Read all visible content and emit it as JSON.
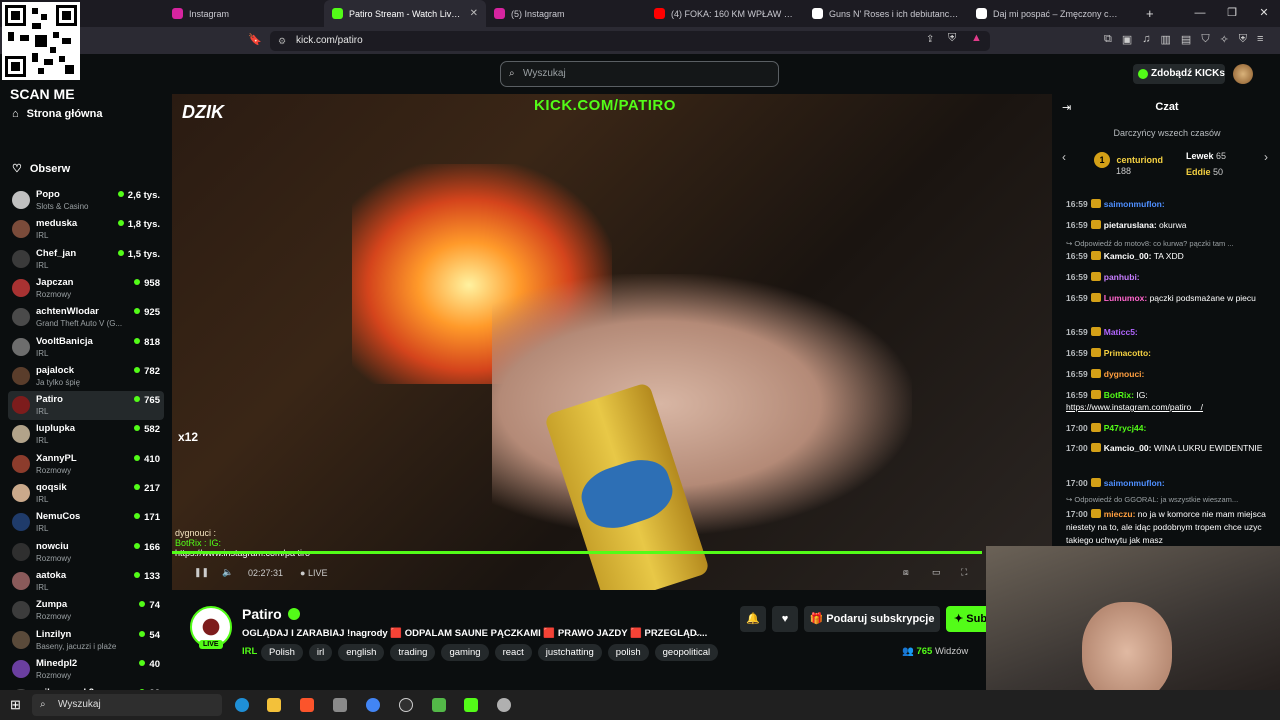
{
  "browser": {
    "tabs": [
      {
        "label": "Instagram",
        "color": "#d6249f",
        "active": false
      },
      {
        "label": "Patiro Stream - Watch Live o",
        "color": "#53fc18",
        "active": true
      },
      {
        "label": "(5) Instagram",
        "color": "#d6249f",
        "active": false
      },
      {
        "label": "(4) FOKA: 160 KM WPŁAW PRZEZ BA",
        "color": "#ff0000",
        "active": false
      },
      {
        "label": "Guns N' Roses i ich debiutancki albu",
        "color": "#ffffff",
        "active": false
      },
      {
        "label": "Daj mi pospać – Zmęczony codz",
        "color": "#ffffff",
        "active": false
      }
    ],
    "url": "kick.com/patiro"
  },
  "overlay": {
    "scan_me": "SCAN ME"
  },
  "header": {
    "search_placeholder": "Wyszukaj",
    "kicks_button": "Zdobądź KICKs"
  },
  "sidebar": {
    "nav": [
      {
        "label": "Strona główna",
        "icon": "home-icon"
      },
      {
        "label": "Obserw",
        "icon": "heart-icon"
      }
    ],
    "channels": [
      {
        "name": "Popo",
        "category": "Slots & Casino",
        "viewers": "2,6 tys.",
        "color": "#c0c0c0"
      },
      {
        "name": "meduska",
        "category": "IRL",
        "viewers": "1,8 tys.",
        "color": "#7a4b3a"
      },
      {
        "name": "Chef_jan",
        "category": "IRL",
        "viewers": "1,5 tys.",
        "color": "#3a3a3a"
      },
      {
        "name": "Japczan",
        "category": "Rozmowy",
        "viewers": "958",
        "color": "#a83232"
      },
      {
        "name": "achtenWlodar",
        "category": "Grand Theft Auto V (G...",
        "viewers": "925",
        "color": "#4a4a4a"
      },
      {
        "name": "VooltBanicja",
        "category": "IRL",
        "viewers": "818",
        "color": "#6d6d6d"
      },
      {
        "name": "pajalock",
        "category": "Ja tylko śpię",
        "viewers": "782",
        "color": "#5a3d2b"
      },
      {
        "name": "Patiro",
        "category": "IRL",
        "viewers": "765",
        "color": "#7d1c1c",
        "selected": true
      },
      {
        "name": "luplupka",
        "category": "IRL",
        "viewers": "582",
        "color": "#b2a38a"
      },
      {
        "name": "XannyPL",
        "category": "Rozmowy",
        "viewers": "410",
        "color": "#8c3c2c"
      },
      {
        "name": "qoqsik",
        "category": "IRL",
        "viewers": "217",
        "color": "#caa98b"
      },
      {
        "name": "NemuCos",
        "category": "IRL",
        "viewers": "171",
        "color": "#1f3b6a"
      },
      {
        "name": "nowciu",
        "category": "Rozmowy",
        "viewers": "166",
        "color": "#2f2f2f"
      },
      {
        "name": "aatoka",
        "category": "IRL",
        "viewers": "133",
        "color": "#8a5a5a"
      },
      {
        "name": "Zumpa",
        "category": "Rozmowy",
        "viewers": "74",
        "color": "#3c3c3c"
      },
      {
        "name": "Linzilyn",
        "category": "Baseny, jacuzzi i plaże",
        "viewers": "54",
        "color": "#5a4a3a"
      },
      {
        "name": "Minedpl2",
        "category": "Rozmowy",
        "viewers": "40",
        "color": "#6b3fa0"
      },
      {
        "name": "mikrocypek2",
        "category": "",
        "viewers": "22",
        "color": "#444444"
      }
    ]
  },
  "video": {
    "watermark": "DZIK",
    "kick_url": "KICK.COM/PATIRO",
    "overlay_chat_user": "dygnouci :",
    "overlay_bot": "BotRix : IG:",
    "overlay_link": "https://www.instagram.com/pa tiro",
    "time": "02:27:31",
    "live_label": "LIVE",
    "multiplier": "x12"
  },
  "stream": {
    "name": "Patiro",
    "live_badge": "LIVE",
    "title": "OGLĄDAJ I ZARABIAJ !nagrody 🟥 ODPALAM SAUNE PĄCZKAMI 🟥 PRAWO JAZDY 🟥 PRZEGLĄD ...",
    "category": "IRL",
    "tags": [
      "Polish",
      "irl",
      "english",
      "trading",
      "gaming",
      "react",
      "justchatting",
      "polish",
      "geopolitical"
    ],
    "gift_sub": "Podaruj subskrypcje",
    "subscribe": "Sub",
    "viewers": "765",
    "viewers_label": "Widzów"
  },
  "chat": {
    "title": "Czat",
    "donors_title": "Darczyńcy wszech czasów",
    "donors": [
      {
        "rank": "1",
        "name": "centuriond",
        "amount": "188"
      },
      {
        "name": "Lewek",
        "amount": "65"
      },
      {
        "name": "Eddie",
        "amount": "50"
      }
    ],
    "messages": [
      {
        "time": "16:59",
        "user": "saimonmuflon:",
        "color": "#4f8fff",
        "text": ""
      },
      {
        "time": "16:59",
        "user": "pietaruslana:",
        "color": "#ffffff",
        "text": "okurwa"
      },
      {
        "reply": "Odpowiedź do motov8: co kurwa? pączki tam ..."
      },
      {
        "time": "16:59",
        "user": "Kamcio_00:",
        "color": "#ffffff",
        "text": "TA XDD"
      },
      {
        "time": "16:59",
        "user": "panhubi:",
        "color": "#c77dff",
        "text": ""
      },
      {
        "time": "16:59",
        "user": "Lumumox:",
        "color": "#ff66cc",
        "text": "pączki podsmażane w piecu"
      },
      {
        "time": "16:59",
        "user": "Maticc5:",
        "color": "#b266ff",
        "text": ""
      },
      {
        "time": "16:59",
        "user": "Primacotto:",
        "color": "#f5d142",
        "text": ""
      },
      {
        "time": "16:59",
        "user": "dygnouci:",
        "color": "#ff9f40",
        "text": ""
      },
      {
        "time": "16:59",
        "user": "BotRix:",
        "color": "#53fc18",
        "text": "IG:"
      },
      {
        "link": "https://www.instagram.com/patiro__/"
      },
      {
        "time": "17:00",
        "user": "P47rycj44:",
        "color": "#53fc18",
        "text": ""
      },
      {
        "time": "17:00",
        "user": "Kamcio_00:",
        "color": "#ffffff",
        "text": "WINA LUKRU EWIDENTNIE"
      },
      {
        "time": "17:00",
        "user": "saimonmuflon:",
        "color": "#4f8fff",
        "text": ""
      },
      {
        "reply": "Odpowiedź do GGORAL: ja wszystkie wieszam..."
      },
      {
        "time": "17:00",
        "user": "mieczu:",
        "color": "#ff9f40",
        "text": "no ja w komorce nie mam miejsca niestety na to, ale idąc podobnym tropem chce uzyc takiego uchwytu jak masz"
      }
    ]
  },
  "taskbar": {
    "search_placeholder": "Wyszukaj"
  }
}
